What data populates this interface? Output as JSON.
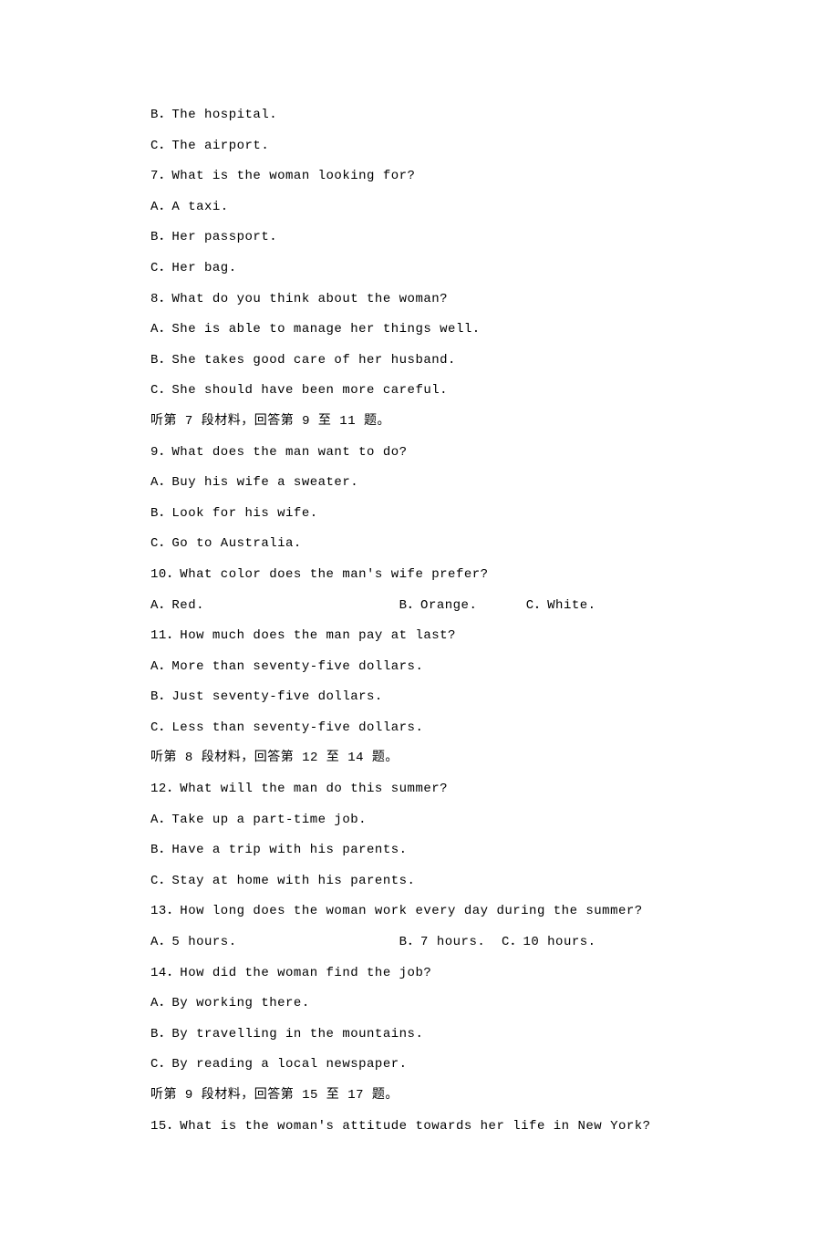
{
  "lines": {
    "l1": "B．The hospital.",
    "l2": "C．The airport.",
    "l3": "7．What is the woman looking for?",
    "l4": "A．A taxi.",
    "l5": "B．Her passport.",
    "l6": "C．Her bag.",
    "l7": "8．What do you think about the woman?",
    "l8": "A．She is able to manage her things well.",
    "l9": "B．She takes good care of her husband.",
    "l10": "C．She should have been more careful.",
    "l11": "听第 7 段材料，回答第 9 至 11 题。",
    "l12": "9．What does the man want to do?",
    "l13": "A．Buy his wife a sweater.",
    "l14": "B．Look for his wife.",
    "l15": "C．Go to Australia.",
    "l16": "10．What color does the man's wife prefer?",
    "l17": "A．Red.                        B．Orange.      C．White.",
    "l18": "11．How much does the man pay at last?",
    "l19": "A．More than seventy-five dollars.",
    "l20": "B．Just seventy-five dollars.",
    "l21": "C．Less than seventy-five dollars.",
    "l22": "听第 8 段材料，回答第 12 至 14 题。",
    "l23": "12．What will the man do this summer?",
    "l24": "A．Take up a part-time job.",
    "l25": "B．Have a trip with his parents.",
    "l26": "C．Stay at home with his parents.",
    "l27": "13．How long does the woman work every day during the summer?",
    "l28": "A．5 hours.                    B．7 hours.  C．10 hours.",
    "l29": "14．How did the woman find the job?",
    "l30": "A．By working there.",
    "l31": "B．By travelling in the mountains.",
    "l32": "C．By reading a local newspaper.",
    "l33": "听第 9 段材料，回答第 15 至 17 题。",
    "l34": "15．What is the woman's attitude towards her life in New York?"
  }
}
